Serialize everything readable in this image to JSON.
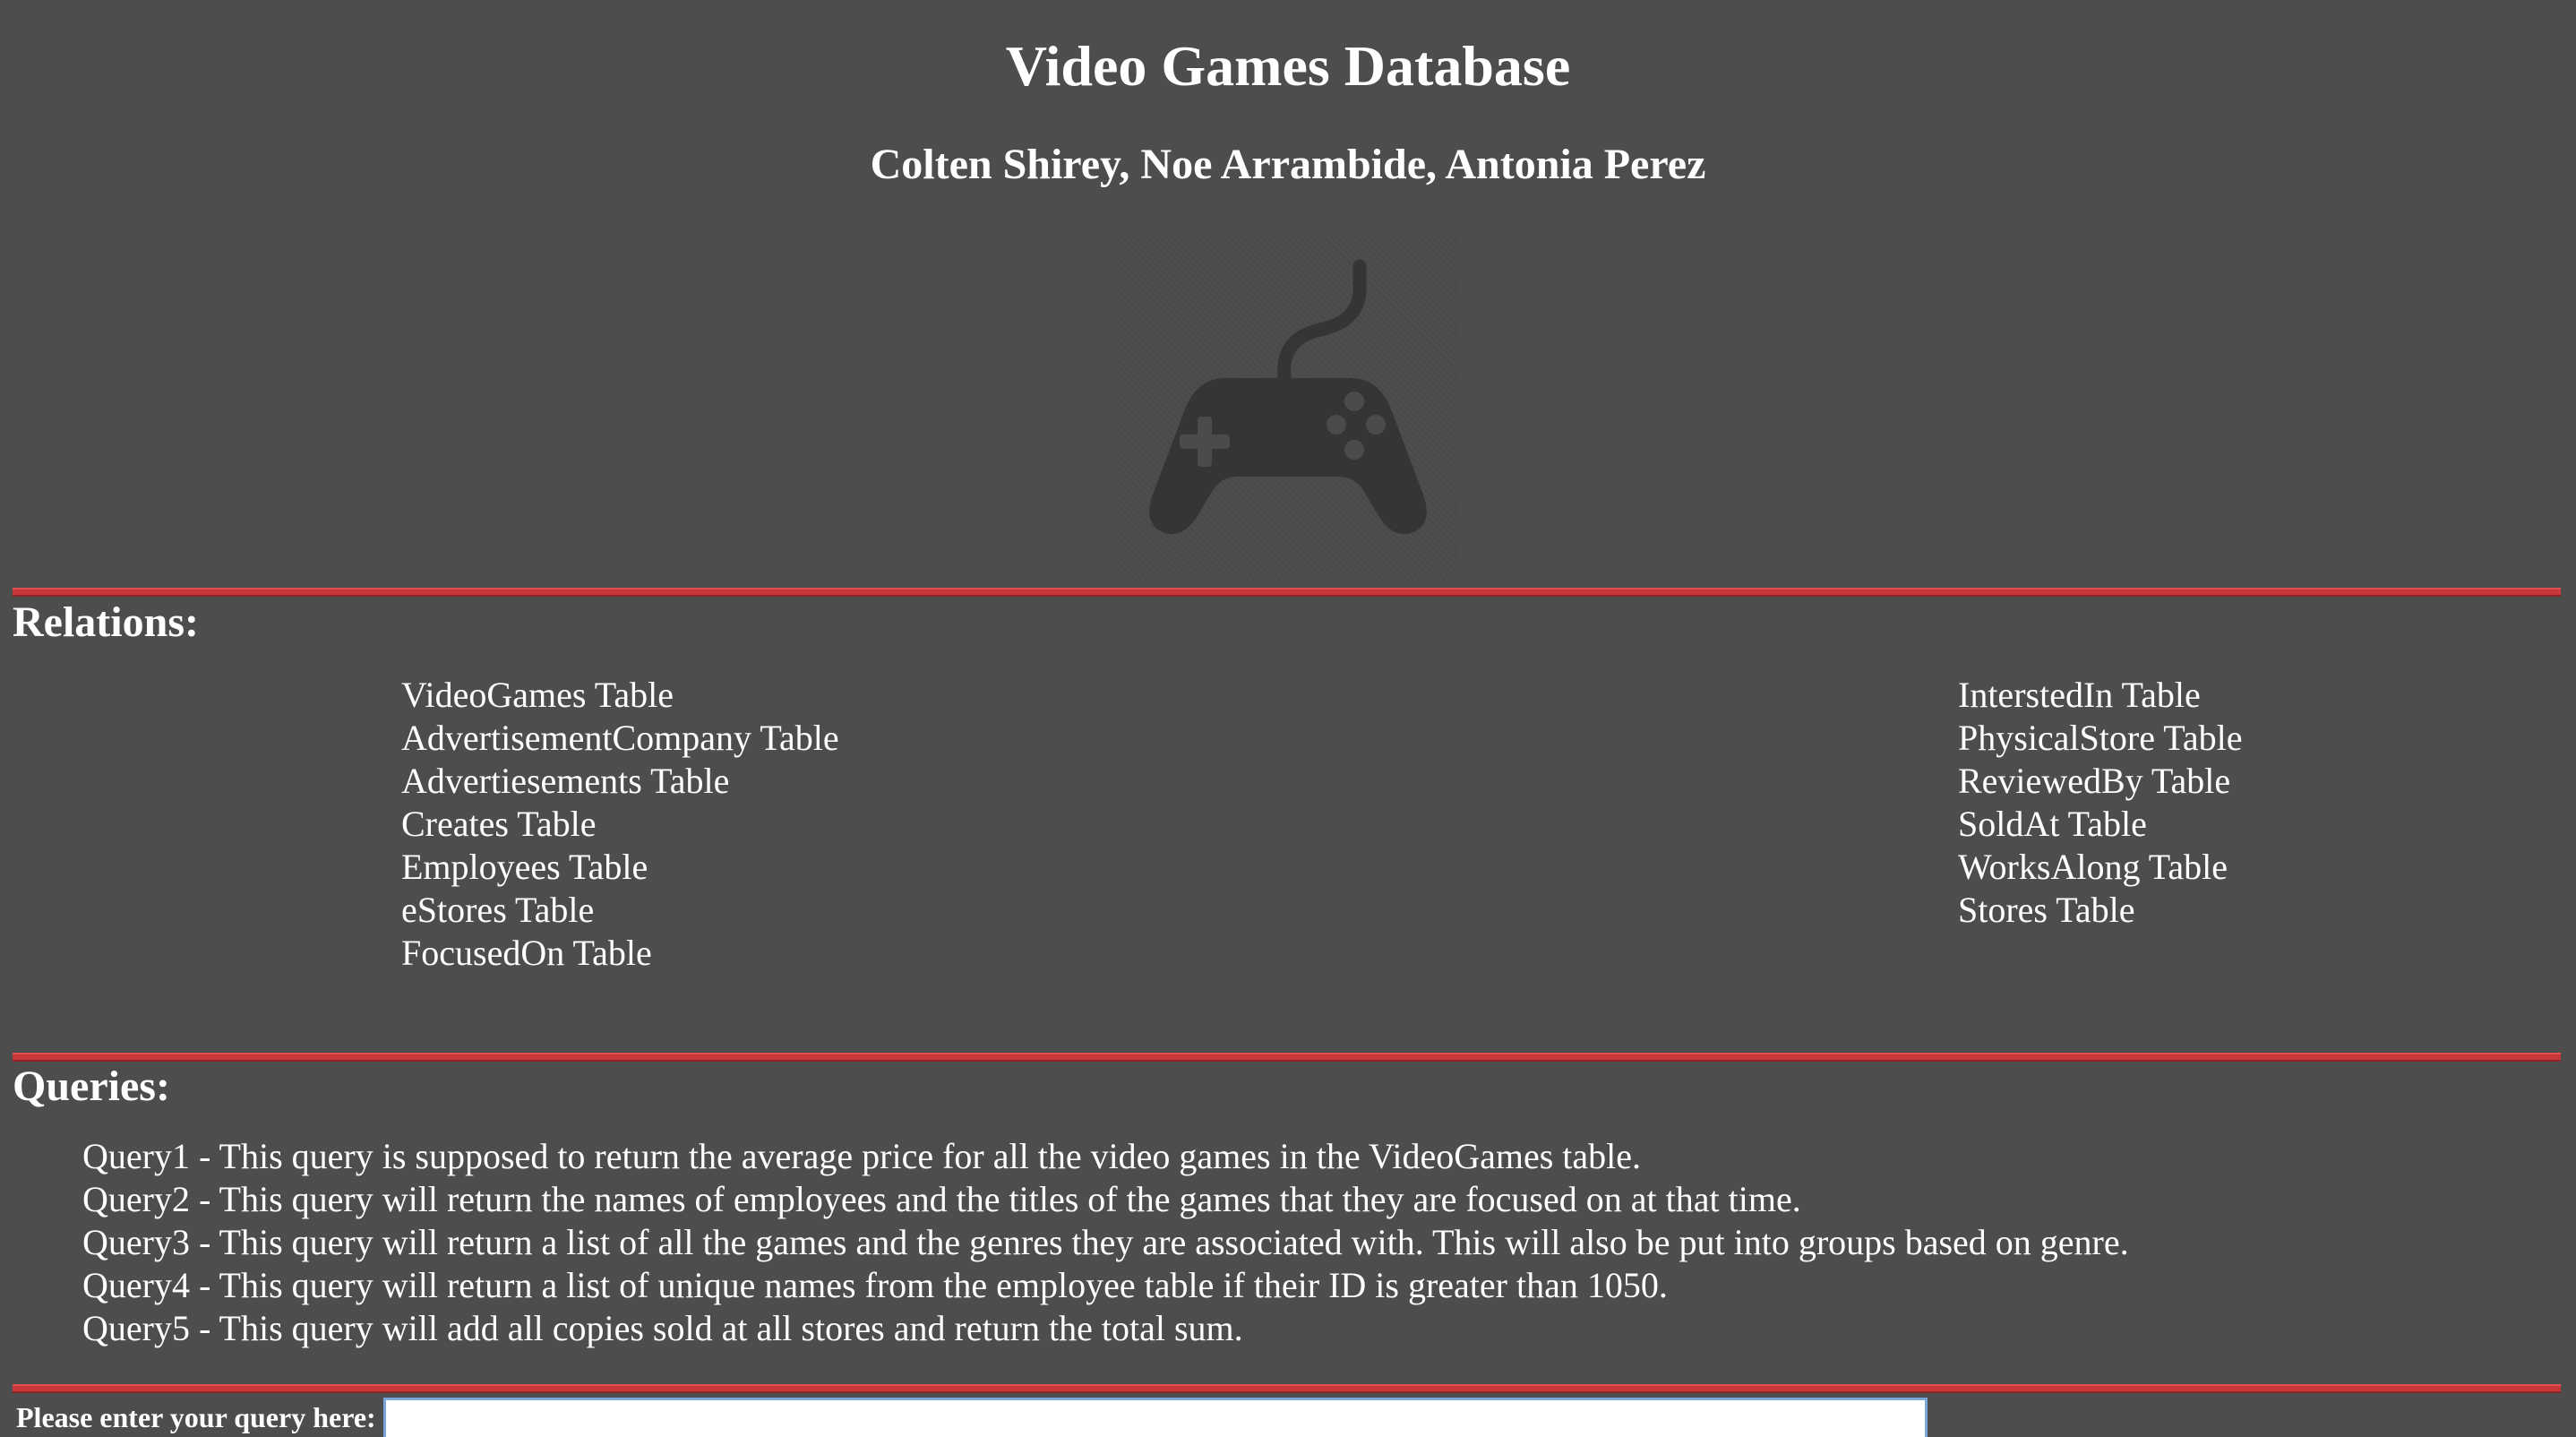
{
  "header": {
    "title": "Video Games Database",
    "authors": "Colten Shirey, Noe Arrambide, Antonia Perez",
    "logo_icon": "gamepad-icon"
  },
  "colors": {
    "background": "#4d4d4d",
    "divider": "#c8373a",
    "text": "#ffffff",
    "logo": "#353535"
  },
  "relations": {
    "heading": "Relations:",
    "left": [
      "VideoGames Table",
      "AdvertisementCompany Table",
      "Advertiesements Table",
      "Creates Table",
      "Employees Table",
      "eStores Table",
      "FocusedOn Table"
    ],
    "right": [
      "InterstedIn Table",
      "PhysicalStore Table",
      "ReviewedBy Table",
      "SoldAt Table",
      "WorksAlong Table",
      "Stores Table"
    ]
  },
  "queries": {
    "heading": "Queries:",
    "items": [
      "Query1 - This query is supposed to return the average price for all the video games in the VideoGames table.",
      "Query2 - This query will return the names of employees and the titles of the games that they are focused on at that time.",
      "Query3 - This query will return a list of all the games and the genres they are associated with. This will also be put into groups based on genre.",
      "Query4 - This query will return a list of unique names from the employee table if their ID is greater than 1050.",
      "Query5 - This query will add all copies sold at all stores and return the total sum."
    ]
  },
  "query_form": {
    "label": "Please enter your query here:",
    "value": ""
  }
}
